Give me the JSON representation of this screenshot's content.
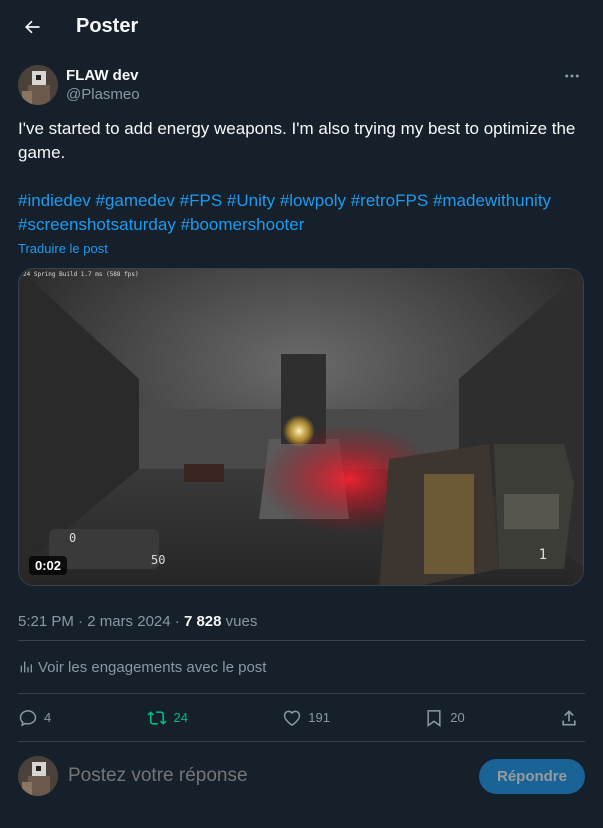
{
  "header": {
    "title": "Poster"
  },
  "author": {
    "display_name": "FLAW dev",
    "handle": "@Plasmeo"
  },
  "tweet": {
    "text": "I've started to add energy weapons. I'm also trying my best to optimize the game.",
    "hashtags": [
      "#indiedev",
      "#gamedev",
      "#FPS",
      "#Unity",
      "#lowpoly",
      "#retroFPS",
      "#madewithunity",
      "#screenshotsaturday",
      "#boomershooter"
    ],
    "translate_label": "Traduire le post"
  },
  "media": {
    "duration": "0:02",
    "overlay_text": "24 Spring Build 1.7 ms (588 fps)",
    "hud_ammo": "0",
    "hud_health": "50",
    "hud_right": "1"
  },
  "meta": {
    "time": "5:21 PM",
    "date": "2 mars 2024",
    "views_count": "7 828",
    "views_label": "vues"
  },
  "engagements_label": "Voir les engagements avec le post",
  "actions": {
    "replies": "4",
    "reposts": "24",
    "likes": "191",
    "bookmarks": "20"
  },
  "reply": {
    "placeholder": "Postez votre réponse",
    "button_label": "Répondre"
  },
  "colors": {
    "background": "#15202b",
    "accent": "#1d9bf0",
    "repost": "#00ba7c",
    "muted": "#8b98a5"
  }
}
